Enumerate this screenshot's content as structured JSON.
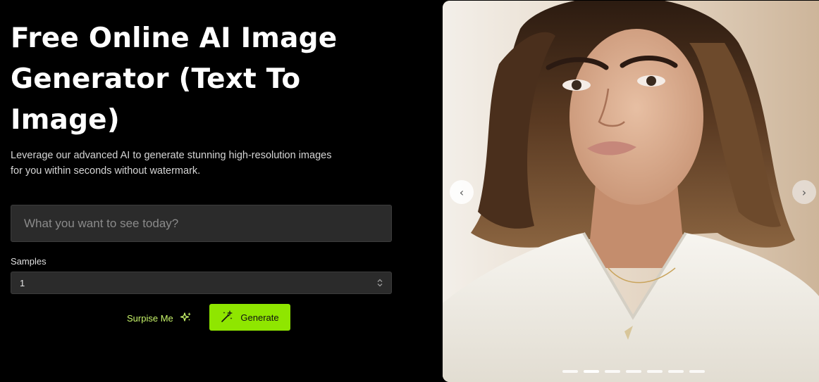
{
  "hero": {
    "title": "Free Online AI Image Generator (Text To Image)",
    "subtitle": "Leverage our advanced AI to generate stunning high-resolution images for you within seconds without watermark."
  },
  "prompt": {
    "placeholder": "What you want to see today?",
    "value": ""
  },
  "samples": {
    "label": "Samples",
    "selected": "1"
  },
  "actions": {
    "surprise_label": "Surpise Me",
    "surprise_icon": "sparkles-icon",
    "generate_label": "Generate",
    "generate_icon": "magic-wand-icon"
  },
  "carousel": {
    "prev_icon": "chevron-left-icon",
    "next_icon": "chevron-right-icon",
    "prev_glyph": "‹",
    "next_glyph": "›",
    "slide_count": 7,
    "active_index": 1
  },
  "colors": {
    "background": "#000000",
    "accent": "#8fe600",
    "surprise_text": "#c8f56a",
    "input_bg": "#2b2b2b"
  }
}
